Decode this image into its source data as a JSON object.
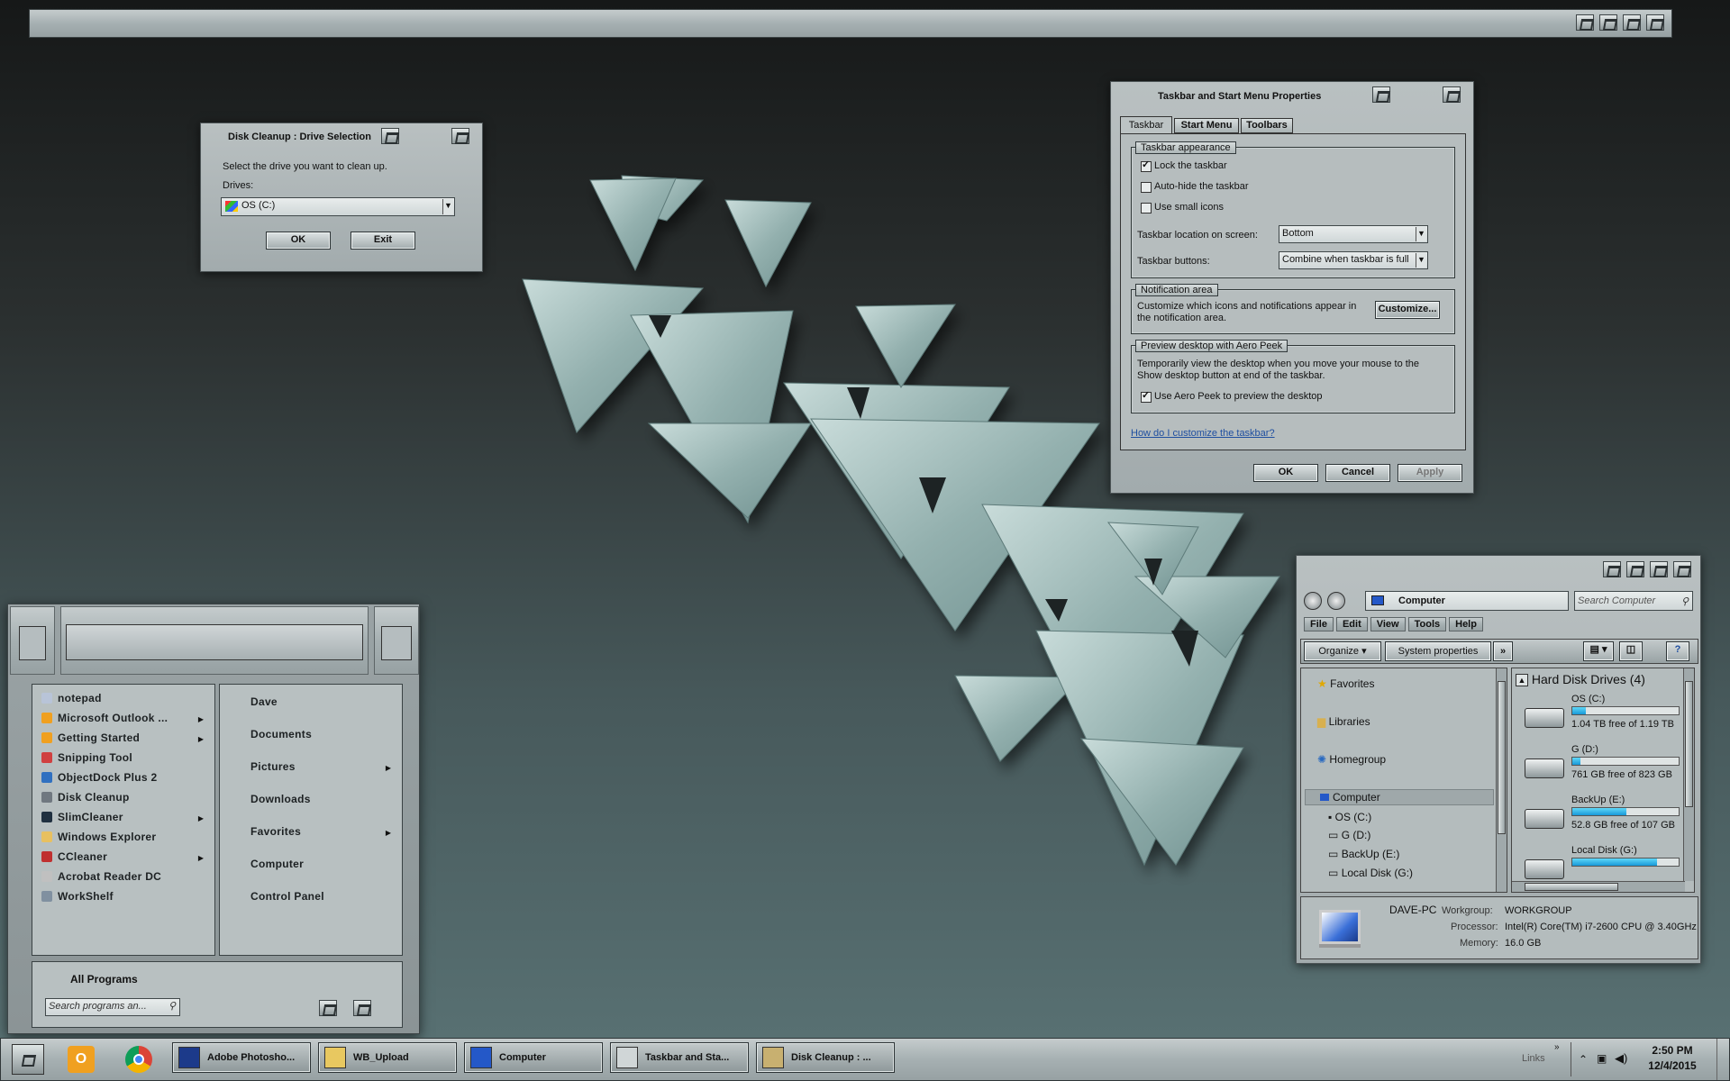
{
  "disk_cleanup": {
    "title": "Disk Cleanup : Drive Selection",
    "prompt": "Select the drive you want to clean up.",
    "drives_label": "Drives:",
    "selected_drive": "OS (C:)",
    "ok": "OK",
    "exit": "Exit"
  },
  "taskbar_props": {
    "title": "Taskbar and Start Menu Properties",
    "tabs": [
      "Taskbar",
      "Start Menu",
      "Toolbars"
    ],
    "appearance": {
      "title": "Taskbar appearance",
      "lock": "Lock the taskbar",
      "autohide": "Auto-hide the taskbar",
      "small_icons": "Use small icons",
      "location_label": "Taskbar location on screen:",
      "location_value": "Bottom",
      "buttons_label": "Taskbar buttons:",
      "buttons_value": "Combine when taskbar is full"
    },
    "notification": {
      "title": "Notification area",
      "text": "Customize which icons and notifications appear in the notification area.",
      "customize": "Customize..."
    },
    "peek": {
      "title": "Preview desktop with Aero Peek",
      "text": "Temporarily view the desktop when you move your mouse to the Show desktop button at end of the taskbar.",
      "checkbox": "Use Aero Peek to preview the desktop"
    },
    "help_link": "How do I customize the taskbar?",
    "ok": "OK",
    "cancel": "Cancel",
    "apply": "Apply"
  },
  "explorer": {
    "breadcrumb": "Computer",
    "search_placeholder": "Search Computer",
    "menu": [
      "File",
      "Edit",
      "View",
      "Tools",
      "Help"
    ],
    "organize": "Organize",
    "system_properties": "System properties",
    "more": "»",
    "nav": {
      "favorites": "Favorites",
      "libraries": "Libraries",
      "homegroup": "Homegroup",
      "computer": "Computer",
      "drives": [
        "OS (C:)",
        "G (D:)",
        "BackUp (E:)",
        "Local Disk (G:)"
      ]
    },
    "group_header": "Hard Disk Drives (4)",
    "drives": [
      {
        "name": "OS (C:)",
        "free": "1.04 TB free of 1.19 TB",
        "used_fraction": 0.13
      },
      {
        "name": "G (D:)",
        "free": "761 GB free of 823 GB",
        "used_fraction": 0.08
      },
      {
        "name": "BackUp (E:)",
        "free": "52.8 GB free of 107 GB",
        "used_fraction": 0.51
      },
      {
        "name": "Local Disk (G:)",
        "free": "",
        "used_fraction": 0.8
      }
    ],
    "details": {
      "name": "DAVE-PC",
      "workgroup_label": "Workgroup:",
      "workgroup": "WORKGROUP",
      "processor_label": "Processor:",
      "processor": "Intel(R) Core(TM) i7-2600 CPU @ 3.40GHz",
      "memory_label": "Memory:",
      "memory": "16.0 GB"
    }
  },
  "start_menu": {
    "programs": [
      {
        "label": "notepad",
        "icon": "notepad-icon",
        "color": "#b8c4d8",
        "submenu": false
      },
      {
        "label": "Microsoft Outlook ...",
        "icon": "outlook-icon",
        "color": "#f0a020",
        "submenu": true
      },
      {
        "label": "Getting Started",
        "icon": "getting-started-icon",
        "color": "#f0a020",
        "submenu": true
      },
      {
        "label": "Snipping Tool",
        "icon": "snipping-tool-icon",
        "color": "#d04040",
        "submenu": false
      },
      {
        "label": "ObjectDock Plus 2",
        "icon": "objectdock-icon",
        "color": "#3070c0",
        "submenu": false
      },
      {
        "label": "Disk Cleanup",
        "icon": "disk-cleanup-icon",
        "color": "#707880",
        "submenu": false
      },
      {
        "label": "SlimCleaner",
        "icon": "slimcleaner-icon",
        "color": "#203040",
        "submenu": true
      },
      {
        "label": "Windows Explorer",
        "icon": "windows-explorer-icon",
        "color": "#e8c060",
        "submenu": false
      },
      {
        "label": "CCleaner",
        "icon": "ccleaner-icon",
        "color": "#c03030",
        "submenu": true
      },
      {
        "label": "Acrobat Reader DC",
        "icon": "acrobat-icon",
        "color": "#c0c0c0",
        "submenu": false
      },
      {
        "label": "WorkShelf",
        "icon": "workshelf-icon",
        "color": "#8090a0",
        "submenu": false
      }
    ],
    "places": [
      {
        "label": "Dave",
        "submenu": false
      },
      {
        "label": "Documents",
        "submenu": false
      },
      {
        "label": "Pictures",
        "submenu": true
      },
      {
        "label": "Downloads",
        "submenu": false
      },
      {
        "label": "Favorites",
        "submenu": true
      },
      {
        "label": "Computer",
        "submenu": false
      },
      {
        "label": "Control Panel",
        "submenu": false
      }
    ],
    "all_programs": "All Programs",
    "search_placeholder": "Search programs an..."
  },
  "taskbar": {
    "tasks": [
      {
        "label": "Adobe Photosho...",
        "icon": "photoshop-icon"
      },
      {
        "label": "WB_Upload",
        "icon": "folder-icon"
      },
      {
        "label": "Computer",
        "icon": "computer-icon"
      },
      {
        "label": "Taskbar and Sta...",
        "icon": "taskbar-properties-icon"
      },
      {
        "label": "Disk Cleanup : ...",
        "icon": "disk-cleanup-icon"
      }
    ],
    "links": "Links",
    "time": "2:50 PM",
    "date": "12/4/2015"
  }
}
